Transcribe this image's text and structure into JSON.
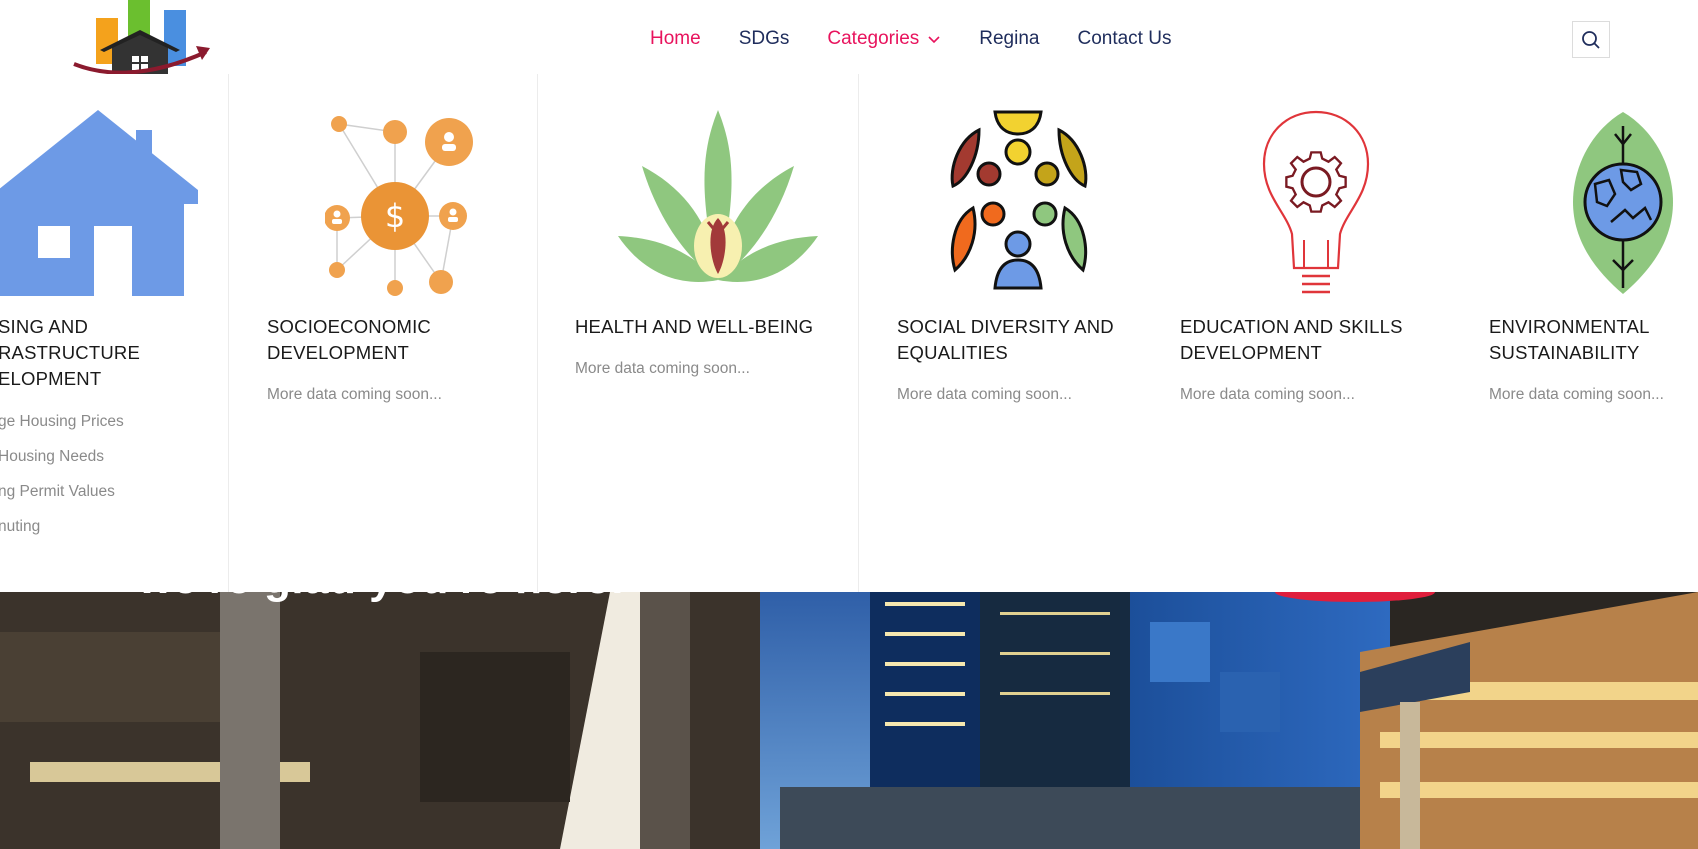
{
  "nav": {
    "items": [
      {
        "label": "Home",
        "state": "active"
      },
      {
        "label": "SDGs",
        "state": ""
      },
      {
        "label": "Categories",
        "state": "open"
      },
      {
        "label": "Regina",
        "state": ""
      },
      {
        "label": "Contact Us",
        "state": ""
      }
    ],
    "active_color": "#e8135d",
    "text_color": "#1f2d5c"
  },
  "search": {
    "icon": "search-icon"
  },
  "categories": [
    {
      "title_lines": [
        "SING AND",
        "RASTRUCTURE",
        "ELOPMENT"
      ],
      "icon": "house-icon",
      "links": [
        "ge Housing Prices",
        "Housing Needs",
        "ng Permit Values",
        "nuting"
      ]
    },
    {
      "title_lines": [
        "SOCIOECONOMIC",
        "DEVELOPMENT"
      ],
      "icon": "socioeconomic-network-icon",
      "note": "More data coming soon..."
    },
    {
      "title_lines": [
        "HEALTH AND WELL-BEING"
      ],
      "icon": "health-lotus-icon",
      "note": "More data coming soon..."
    },
    {
      "title_lines": [
        "SOCIAL DIVERSITY AND",
        "EQUALITIES"
      ],
      "icon": "diversity-people-icon",
      "note": "More data coming soon..."
    },
    {
      "title_lines": [
        "EDUCATION AND SKILLS",
        "DEVELOPMENT"
      ],
      "icon": "lightbulb-gear-icon",
      "note": "More data coming soon..."
    },
    {
      "title_lines": [
        "ENVIRONMENTAL",
        "SUSTAINABILITY"
      ],
      "icon": "leaf-globe-icon",
      "note": "More data coming soon..."
    }
  ],
  "hero": {
    "text": "we're glad you're here!"
  }
}
